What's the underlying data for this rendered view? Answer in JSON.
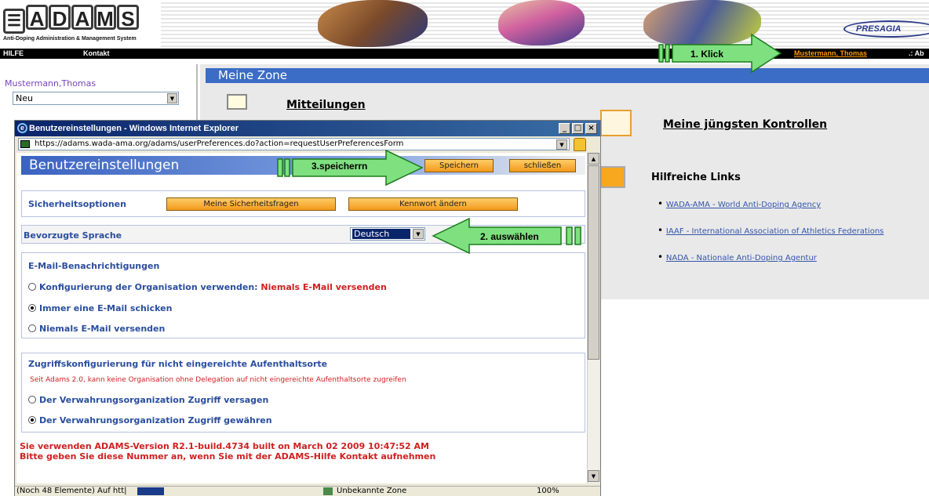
{
  "header": {
    "logo_letters": [
      "A",
      "D",
      "A",
      "M",
      "S"
    ],
    "logo_subtitle": "Anti-Doping Administration & Management System",
    "brand_right": "PRESAGIA"
  },
  "navbar": {
    "help": "HILFE",
    "contact": "Kontakt",
    "user_link": "Mustermann, Thomas",
    "logout_fragment": ".: Ab"
  },
  "left_panel": {
    "user_name": "Mustermann,Thomas",
    "select_value": "Neu"
  },
  "zone": {
    "title": "Meine Zone",
    "messages": "Mitteilungen",
    "controls": "Meine jüngsten Kontrollen",
    "links_title": "Hilfreiche Links",
    "links": [
      "WADA-AMA - World Anti-Doping Agency",
      "IAAF - International Association of Athletics Federations",
      "NADA - Nationale Anti-Doping Agentur"
    ]
  },
  "popup": {
    "window_title": "Benutzereinstellungen - Windows Internet Explorer",
    "url": "https://adams.wada-ama.org/adams/userPreferences.do?action=requestUserPreferencesForm",
    "page_title": "Benutzereinstellungen",
    "save_button": "Speichern",
    "close_button": "schließen",
    "security_label": "Sicherheitsoptionen",
    "security_questions_button": "Meine Sicherheitsfragen",
    "change_password_button": "Kennwort ändern",
    "language_label": "Bevorzugte Sprache",
    "language_value": "Deutsch",
    "email_title": "E-Mail-Benachrichtigungen",
    "email_opt1": "Konfigurierung der Organisation verwenden:",
    "email_opt1_value": "Niemals E-Mail versenden",
    "email_opt2": "Immer eine E-Mail schicken",
    "email_opt3": "Niemals E-Mail versenden",
    "access_title": "Zugriffskonfigurierung für nicht eingereichte Aufenthaltsorte",
    "access_note": "Seit Adams 2.0, kann keine Organisation ohne Delegation auf nicht eingereichte Aufenthaltsorte zugreifen",
    "access_opt1": "Der Verwahrungsorganization Zugriff versagen",
    "access_opt2": "Der Verwahrungsorganization Zugriff gewähren",
    "version_line1": "Sie verwenden ADAMS-Version R2.1-build.4734 built on March 02 2009 10:47:52 AM",
    "version_line2": "Bitte geben Sie diese Nummer an, wenn Sie mit der ADAMS-Hilfe Kontakt aufnehmen",
    "status_left": "(Noch 48 Elemente) Auf htt|",
    "status_zone": "Unbekannte Zone",
    "status_zoom": "100%"
  },
  "annotations": {
    "step1": "1. Klick",
    "step2": "2. auswählen",
    "step3": "3.speicherrn"
  },
  "colors": {
    "zone_bar": "#3b6cc6",
    "arrow_green": "#7fe07f",
    "orange_button": "#f29a1c",
    "user_link": "#ff9900"
  }
}
